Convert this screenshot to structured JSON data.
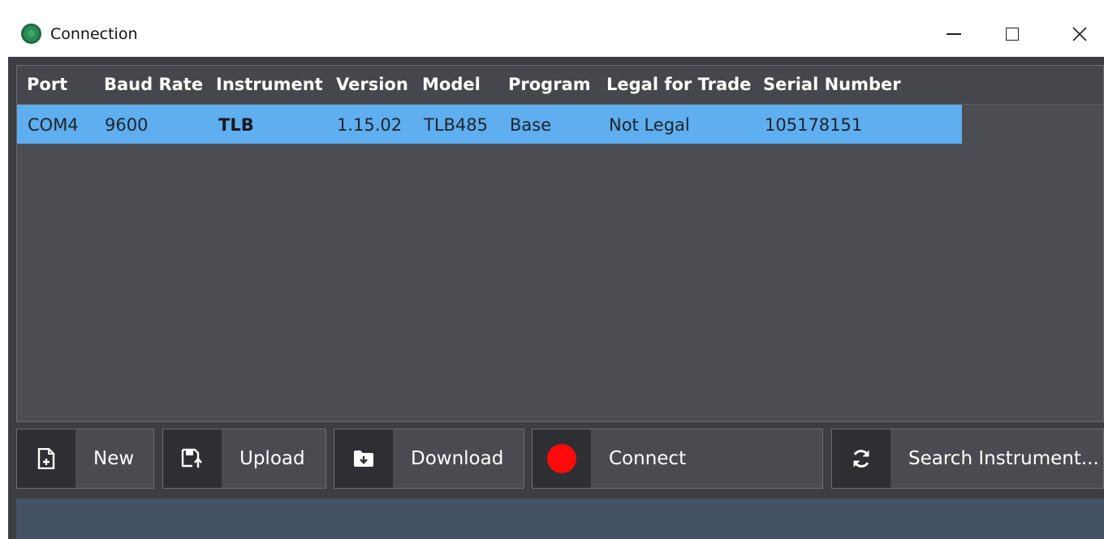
{
  "window": {
    "title": "Connection",
    "controls": [
      "minimize-icon",
      "maximize-icon",
      "close-icon"
    ]
  },
  "table": {
    "columns": [
      "Port",
      "Baud Rate",
      "Instrument",
      "Version",
      "Model",
      "Program",
      "Legal for Trade",
      "Serial Number"
    ],
    "rows": [
      {
        "port": "COM4",
        "baud_rate": "9600",
        "instrument": "TLB",
        "version": "1.15.02",
        "model": "TLB485",
        "program": "Base",
        "legal_for_trade": "Not Legal",
        "serial_number": "105178151",
        "selected": true
      }
    ]
  },
  "buttons": {
    "new": {
      "label": "New",
      "icon": "new-file-icon"
    },
    "upload": {
      "label": "Upload",
      "icon": "upload-save-icon"
    },
    "download": {
      "label": "Download",
      "icon": "download-folder-icon"
    },
    "connect": {
      "label": "Connect",
      "icon": "record-dot-icon"
    },
    "search": {
      "label": "Search Instrument...",
      "icon": "refresh-icon"
    }
  },
  "colors": {
    "selected_row": "#5eaef0",
    "connect_indicator": "#ff0a0a",
    "status_bar": "#445264"
  }
}
